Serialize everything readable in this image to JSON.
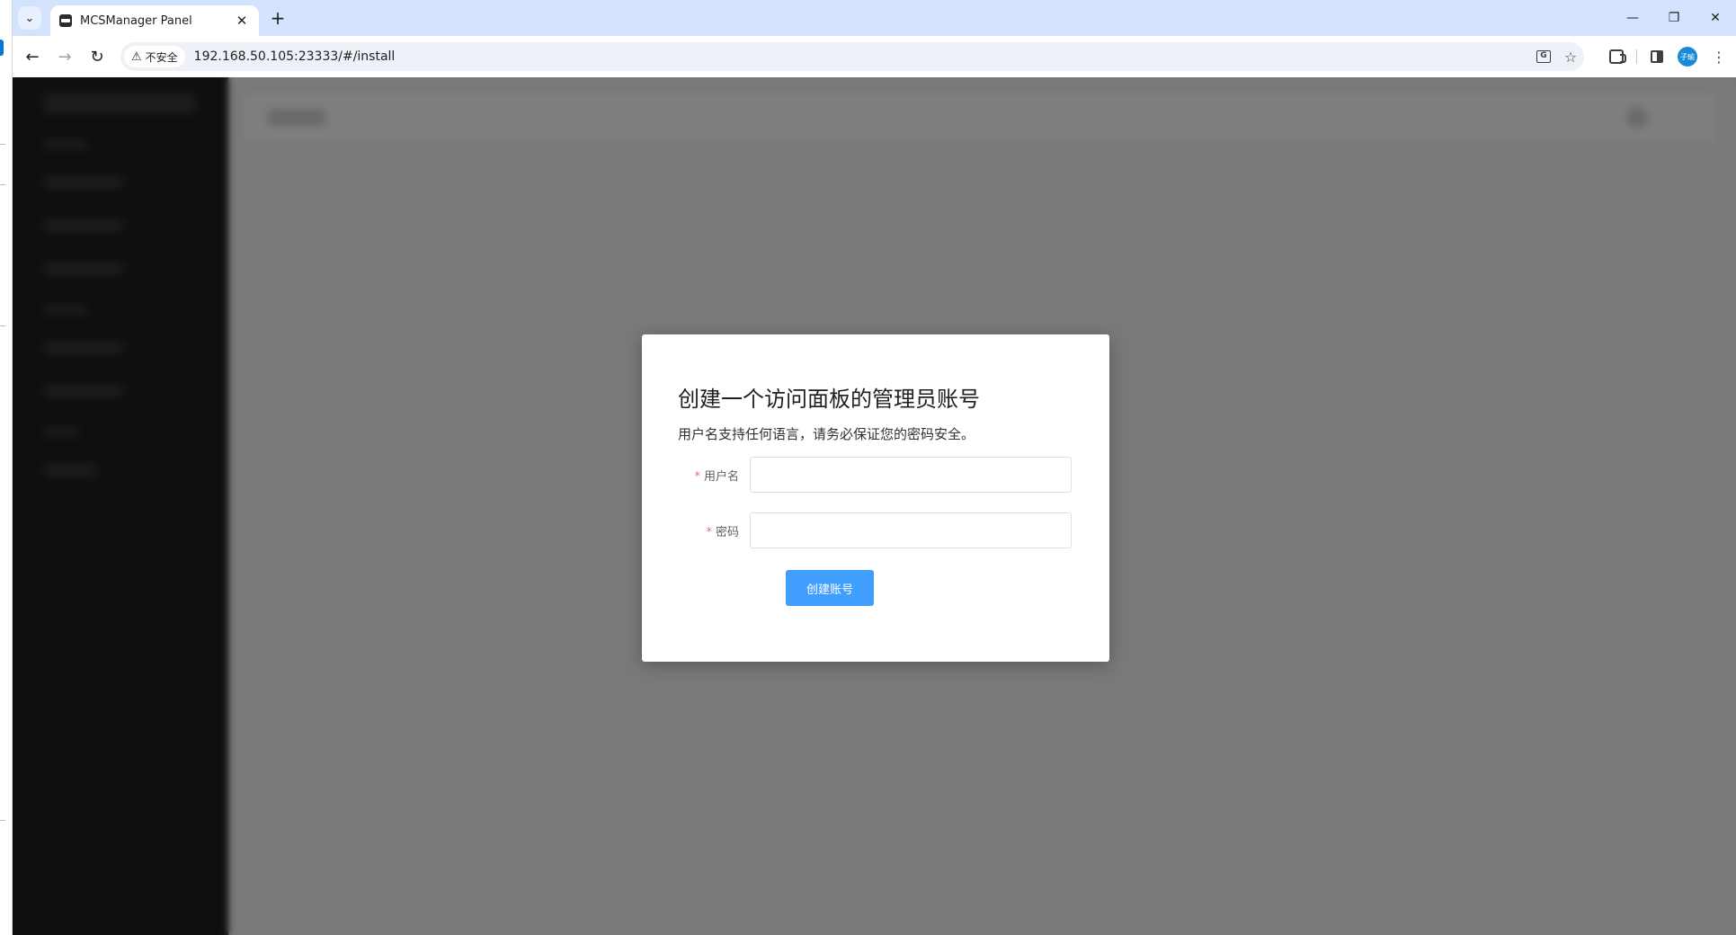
{
  "browser": {
    "tab": {
      "title": "MCSManager Panel"
    },
    "omnibox": {
      "security_label": "不安全",
      "url": "192.168.50.105:23333/#/install"
    },
    "profile_initials": "子瑜"
  },
  "install_modal": {
    "title": "创建一个访问面板的管理员账号",
    "subtitle": "用户名支持任何语言，请务必保证您的密码安全。",
    "username": {
      "label": "用户名",
      "value": ""
    },
    "password": {
      "label": "密码",
      "value": ""
    },
    "submit_label": "创建账号"
  },
  "colors": {
    "accent": "#409eff",
    "required_star": "#f56c6c",
    "chrome_tabstrip": "#d3e3fd"
  }
}
